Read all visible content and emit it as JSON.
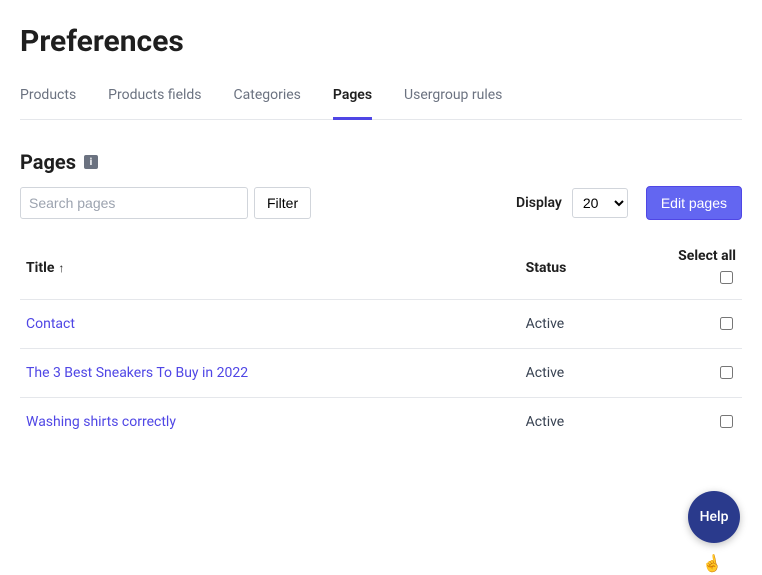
{
  "header": {
    "title": "Preferences"
  },
  "tabs": [
    {
      "label": "Products",
      "active": false
    },
    {
      "label": "Products fields",
      "active": false
    },
    {
      "label": "Categories",
      "active": false
    },
    {
      "label": "Pages",
      "active": true
    },
    {
      "label": "Usergroup rules",
      "active": false
    }
  ],
  "section": {
    "title": "Pages"
  },
  "search": {
    "placeholder": "Search pages",
    "value": ""
  },
  "filter": {
    "label": "Filter"
  },
  "display": {
    "label": "Display",
    "value": "20"
  },
  "edit_button": {
    "label": "Edit pages"
  },
  "table": {
    "columns": {
      "title": "Title",
      "status": "Status",
      "select_all": "Select all"
    },
    "sort": {
      "column": "title",
      "direction": "asc"
    },
    "rows": [
      {
        "title": "Contact",
        "status": "Active",
        "selected": false
      },
      {
        "title": "The 3 Best Sneakers To Buy in 2022",
        "status": "Active",
        "selected": false
      },
      {
        "title": "Washing shirts correctly",
        "status": "Active",
        "selected": false
      }
    ]
  },
  "help_fab": {
    "label": "Help"
  }
}
